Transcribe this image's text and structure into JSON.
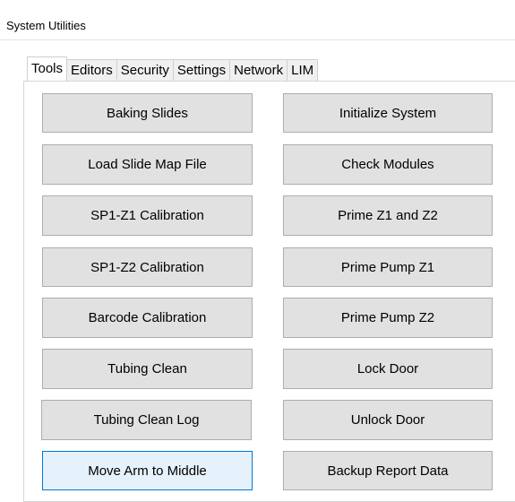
{
  "window": {
    "title": "System Utilities"
  },
  "tabs": [
    {
      "label": "Tools",
      "active": true
    },
    {
      "label": "Editors",
      "active": false
    },
    {
      "label": "Security",
      "active": false
    },
    {
      "label": "Settings",
      "active": false
    },
    {
      "label": "Network",
      "active": false
    },
    {
      "label": "LIM",
      "active": false
    }
  ],
  "tools": {
    "left_column": [
      "Baking Slides",
      "Load Slide Map File",
      "SP1-Z1 Calibration",
      "SP1-Z2 Calibration",
      "Barcode Calibration",
      "Tubing Clean",
      "Tubing Clean Log",
      "Move Arm to Middle"
    ],
    "right_column": [
      "Initialize System",
      "Check Modules",
      "Prime Z1 and Z2",
      "Prime Pump Z1",
      "Prime Pump Z2",
      "Lock Door",
      "Unlock Door",
      "Backup Report Data"
    ],
    "hovered_button": "Move Arm to Middle"
  },
  "colors": {
    "button_face": "#e1e1e1",
    "button_border": "#adadad",
    "hover_face": "#e5f1fb",
    "hover_border": "#0078d7"
  }
}
